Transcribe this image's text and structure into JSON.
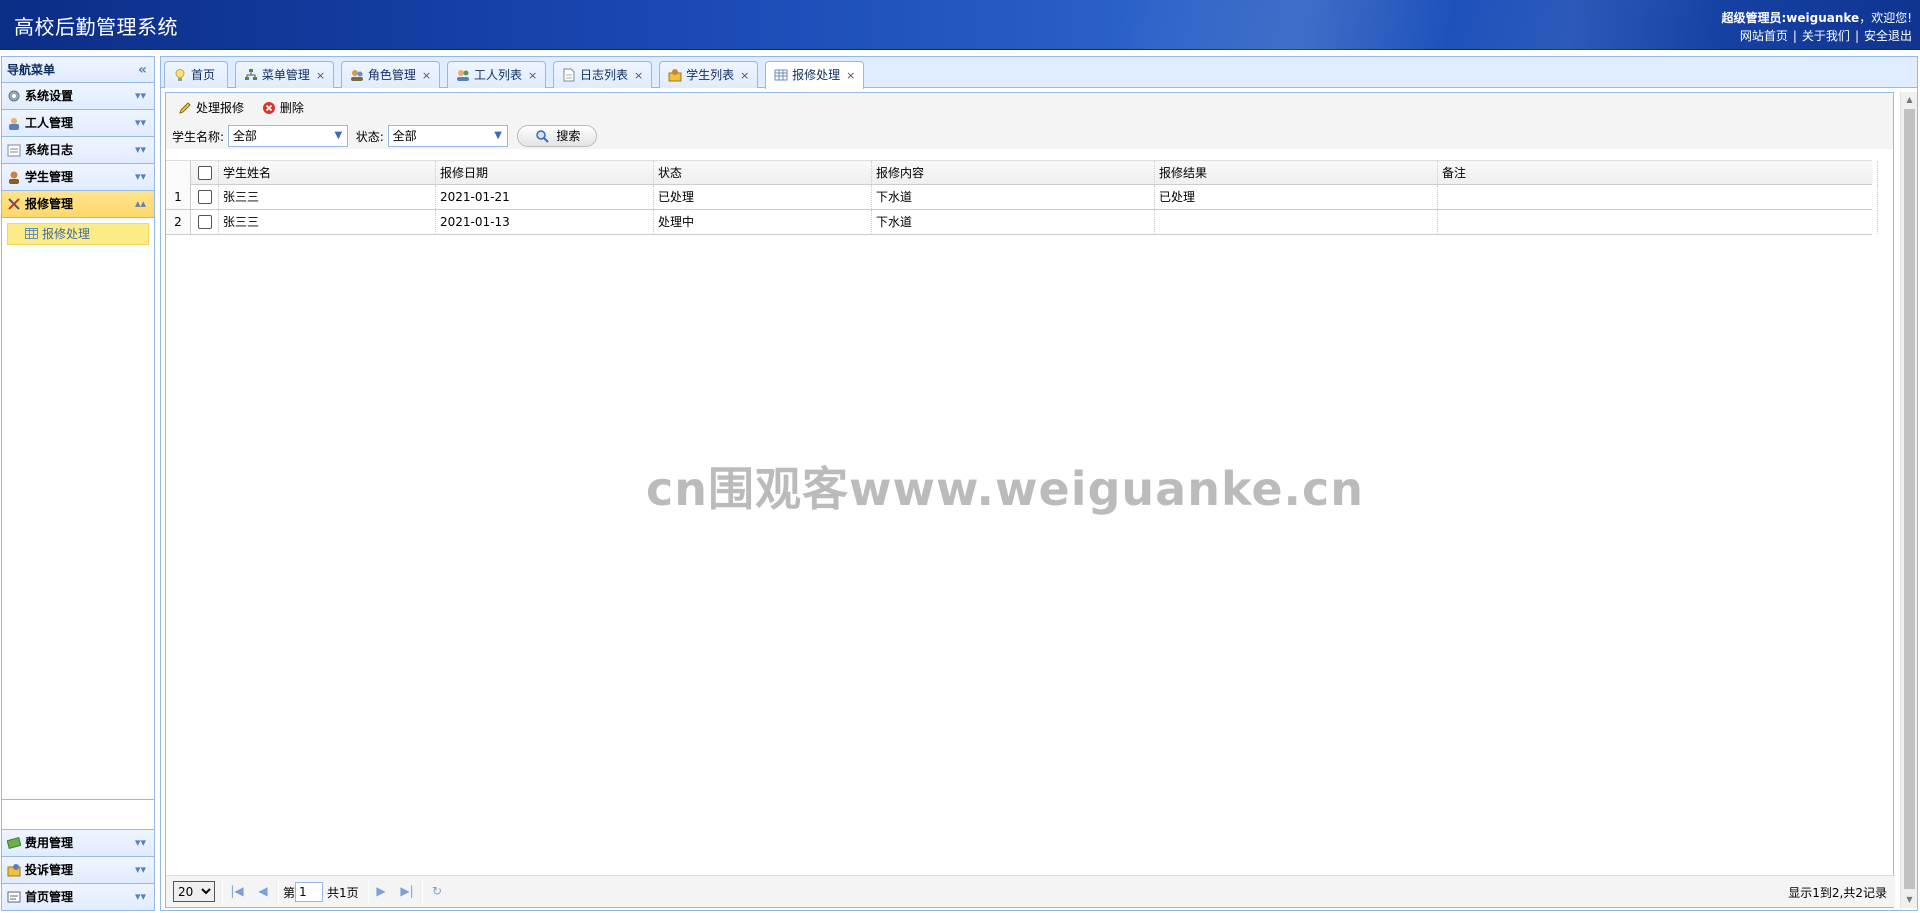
{
  "header": {
    "app_title": "高校后勤管理系统",
    "greeting_prefix": "超级管理员:",
    "username": "weiguanke",
    "greeting_suffix": "，欢迎您!",
    "links": [
      "网站首页",
      "关于我们",
      "安全退出"
    ]
  },
  "sidebar": {
    "title": "导航菜单",
    "menus": [
      {
        "label": "系统设置",
        "icon": "gear-icon"
      },
      {
        "label": "工人管理",
        "icon": "worker-icon"
      },
      {
        "label": "系统日志",
        "icon": "log-icon"
      },
      {
        "label": "学生管理",
        "icon": "student-icon"
      },
      {
        "label": "报修管理",
        "icon": "tools-icon",
        "active": true
      }
    ],
    "sub_items": [
      {
        "label": "报修处理",
        "icon": "table-icon"
      }
    ],
    "bottom_menus": [
      {
        "label": "费用管理",
        "icon": "money-icon"
      },
      {
        "label": "投诉管理",
        "icon": "complaint-icon"
      },
      {
        "label": "首页管理",
        "icon": "homepage-icon"
      }
    ]
  },
  "tabs": [
    {
      "label": "首页",
      "icon": "bulb-icon",
      "closable": false
    },
    {
      "label": "菜单管理",
      "icon": "menu-tree-icon",
      "closable": true
    },
    {
      "label": "角色管理",
      "icon": "role-icon",
      "closable": true
    },
    {
      "label": "工人列表",
      "icon": "worker-list-icon",
      "closable": true
    },
    {
      "label": "日志列表",
      "icon": "doc-icon",
      "closable": true
    },
    {
      "label": "学生列表",
      "icon": "student-list-icon",
      "closable": true
    },
    {
      "label": "报修处理",
      "icon": "table-icon",
      "closable": true,
      "active": true
    }
  ],
  "toolbar": {
    "process_label": "处理报修",
    "delete_label": "删除"
  },
  "filters": {
    "student_label": "学生名称:",
    "student_value": "全部",
    "status_label": "状态:",
    "status_value": "全部",
    "search_label": "搜索"
  },
  "table": {
    "columns": [
      "学生姓名",
      "报修日期",
      "状态",
      "报修内容",
      "报修结果",
      "备注"
    ],
    "rows": [
      {
        "num": "1",
        "cells": [
          "张三三",
          "2021-01-21",
          "已处理",
          "下水道",
          "已处理",
          ""
        ]
      },
      {
        "num": "2",
        "cells": [
          "张三三",
          "2021-01-13",
          "处理中",
          "下水道",
          "",
          ""
        ]
      }
    ]
  },
  "watermark": "cn围观客www.weiguanke.cn",
  "pager": {
    "page_size": "20",
    "page_prefix": "第",
    "page_value": "1",
    "page_suffix": "共1页",
    "info": "显示1到2,共2记录"
  },
  "colors": {
    "header_bg": "#1a48b4",
    "border": "#95b8e7",
    "active_menu": "#ffd86b",
    "accent_blue": "#0e2d5f"
  }
}
